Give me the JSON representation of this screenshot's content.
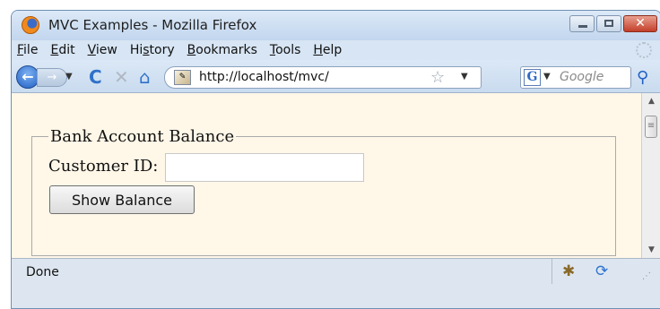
{
  "window": {
    "title": "MVC Examples - Mozilla Firefox",
    "app_icon": "firefox-icon",
    "controls": {
      "minimize": "minimize-icon",
      "maximize": "maximize-icon",
      "close": "close-icon",
      "close_glyph": "✕"
    }
  },
  "menubar": {
    "items": [
      {
        "key": "F",
        "rest": "ile"
      },
      {
        "key": "E",
        "rest": "dit"
      },
      {
        "key": "V",
        "rest": "iew"
      },
      {
        "pre": "Hi",
        "key": "s",
        "rest": "tory"
      },
      {
        "key": "B",
        "rest": "ookmarks"
      },
      {
        "key": "T",
        "rest": "ools"
      },
      {
        "key": "H",
        "rest": "elp"
      }
    ]
  },
  "navbar": {
    "back": "←",
    "forward": "→",
    "reload": "C",
    "stop": "✕",
    "home": "⌂",
    "url": "http://localhost/mvc/",
    "bookmark_star": "☆",
    "search_engine": "G",
    "search_placeholder": "Google",
    "search_go": "⚲"
  },
  "page": {
    "fieldset_legend": "Bank Account Balance",
    "customer_id_label": "Customer ID:",
    "customer_id_value": "",
    "show_button": "Show Balance",
    "background": "#fff7e8"
  },
  "statusbar": {
    "text": "Done"
  }
}
